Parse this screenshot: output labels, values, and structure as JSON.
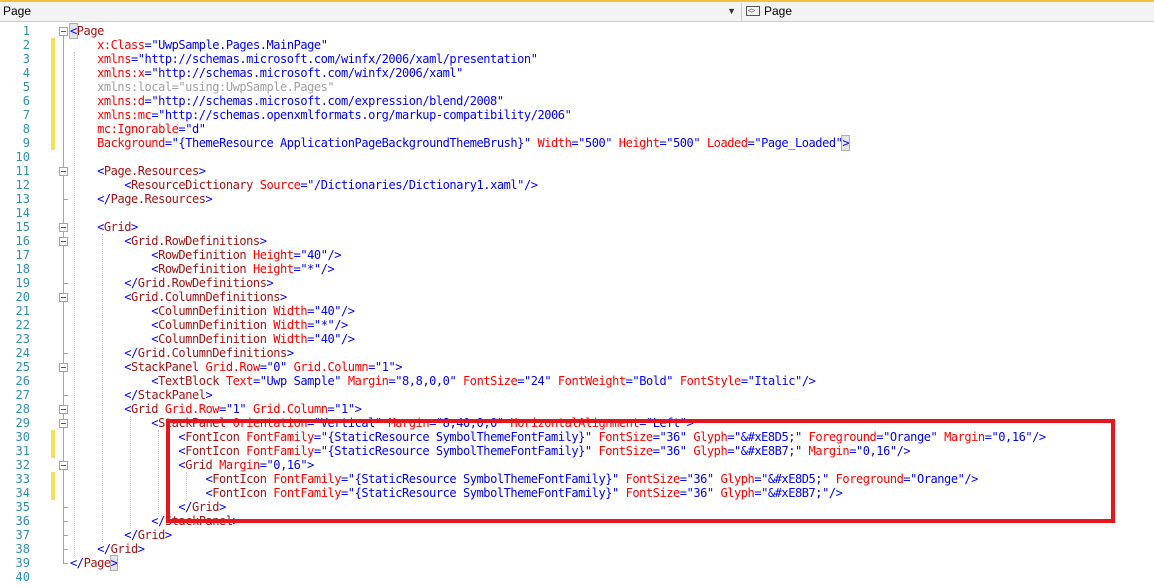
{
  "navbar": {
    "left_dropdown": "Page",
    "right_dropdown": "Page",
    "arrow_glyph": "▼"
  },
  "editor": {
    "lines": [
      {
        "n": "1",
        "code": "<Page"
      },
      {
        "n": "2",
        "code": "    x:Class=\"UwpSample.Pages.MainPage\""
      },
      {
        "n": "3",
        "code": "    xmlns=\"http://schemas.microsoft.com/winfx/2006/xaml/presentation\""
      },
      {
        "n": "4",
        "code": "    xmlns:x=\"http://schemas.microsoft.com/winfx/2006/xaml\""
      },
      {
        "n": "5",
        "code": "    xmlns:local=\"using:UwpSample.Pages\""
      },
      {
        "n": "6",
        "code": "    xmlns:d=\"http://schemas.microsoft.com/expression/blend/2008\""
      },
      {
        "n": "7",
        "code": "    xmlns:mc=\"http://schemas.openxmlformats.org/markup-compatibility/2006\""
      },
      {
        "n": "8",
        "code": "    mc:Ignorable=\"d\""
      },
      {
        "n": "9",
        "code": "    Background=\"{ThemeResource ApplicationPageBackgroundThemeBrush}\" Width=\"500\" Height=\"500\" Loaded=\"Page_Loaded\">"
      },
      {
        "n": "10",
        "code": ""
      },
      {
        "n": "11",
        "code": "    <Page.Resources>"
      },
      {
        "n": "12",
        "code": "        <ResourceDictionary Source=\"/Dictionaries/Dictionary1.xaml\"/>"
      },
      {
        "n": "13",
        "code": "    </Page.Resources>"
      },
      {
        "n": "14",
        "code": ""
      },
      {
        "n": "15",
        "code": "    <Grid>"
      },
      {
        "n": "16",
        "code": "        <Grid.RowDefinitions>"
      },
      {
        "n": "17",
        "code": "            <RowDefinition Height=\"40\"/>"
      },
      {
        "n": "18",
        "code": "            <RowDefinition Height=\"*\"/>"
      },
      {
        "n": "19",
        "code": "        </Grid.RowDefinitions>"
      },
      {
        "n": "20",
        "code": "        <Grid.ColumnDefinitions>"
      },
      {
        "n": "21",
        "code": "            <ColumnDefinition Width=\"40\"/>"
      },
      {
        "n": "22",
        "code": "            <ColumnDefinition Width=\"*\"/>"
      },
      {
        "n": "23",
        "code": "            <ColumnDefinition Width=\"40\"/>"
      },
      {
        "n": "24",
        "code": "        </Grid.ColumnDefinitions>"
      },
      {
        "n": "25",
        "code": "        <StackPanel Grid.Row=\"0\" Grid.Column=\"1\">"
      },
      {
        "n": "26",
        "code": "            <TextBlock Text=\"Uwp Sample\" Margin=\"8,8,0,0\" FontSize=\"24\" FontWeight=\"Bold\" FontStyle=\"Italic\"/>"
      },
      {
        "n": "27",
        "code": "        </StackPanel>"
      },
      {
        "n": "28",
        "code": "        <Grid Grid.Row=\"1\" Grid.Column=\"1\">"
      },
      {
        "n": "29",
        "code": "            <StackPanel Orientation=\"Vertical\" Margin=\"8,40,0,0\" HorizontalAlignment=\"Left\">"
      },
      {
        "n": "30",
        "code": "                <FontIcon FontFamily=\"{StaticResource SymbolThemeFontFamily}\" FontSize=\"36\" Glyph=\"&#xE8D5;\" Foreground=\"Orange\" Margin=\"0,16\"/>"
      },
      {
        "n": "31",
        "code": "                <FontIcon FontFamily=\"{StaticResource SymbolThemeFontFamily}\" FontSize=\"36\" Glyph=\"&#xE8B7;\" Margin=\"0,16\"/>"
      },
      {
        "n": "32",
        "code": "                <Grid Margin=\"0,16\">"
      },
      {
        "n": "33",
        "code": "                    <FontIcon FontFamily=\"{StaticResource SymbolThemeFontFamily}\" FontSize=\"36\" Glyph=\"&#xE8D5;\" Foreground=\"Orange\"/>"
      },
      {
        "n": "34",
        "code": "                    <FontIcon FontFamily=\"{StaticResource SymbolThemeFontFamily}\" FontSize=\"36\" Glyph=\"&#xE8B7;\"/>"
      },
      {
        "n": "35",
        "code": "                </Grid>"
      },
      {
        "n": "36",
        "code": "            </StackPanel>"
      },
      {
        "n": "37",
        "code": "        </Grid>"
      },
      {
        "n": "38",
        "code": "    </Grid>"
      },
      {
        "n": "39",
        "code": "</Page>"
      },
      {
        "n": "40",
        "code": ""
      }
    ]
  },
  "colors": {
    "tag": "#a31515",
    "attribute": "#ff0000",
    "value": "#0000ff",
    "unused_namespace": "#a0a0a0",
    "line_number": "#2b91af",
    "highlight_box": "#e8151d",
    "change_marker": "#f1e25a"
  }
}
